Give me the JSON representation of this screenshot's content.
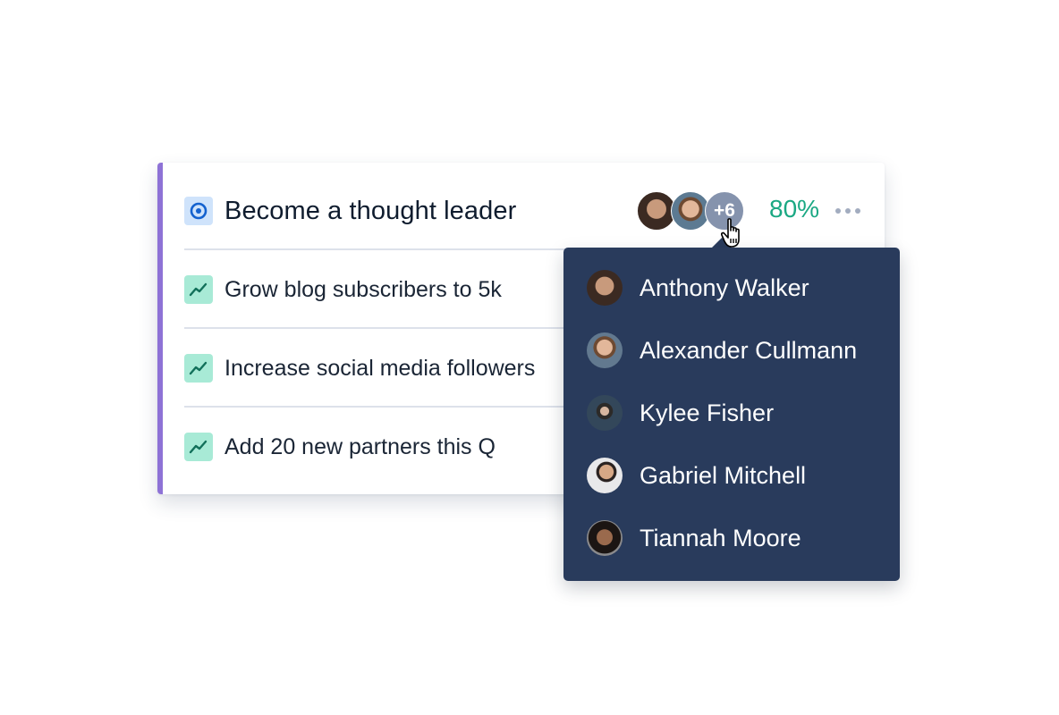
{
  "objective": {
    "title": "Become a thought leader",
    "icon": "target-icon",
    "progress_label": "80%",
    "progress": 0.8,
    "owners_overflow_label": "+6",
    "more_menu_icon": "more-horizontal-icon"
  },
  "key_results": [
    {
      "title": "Grow blog subscribers to 5k",
      "icon": "trend-up-icon"
    },
    {
      "title": "Increase social media followers",
      "icon": "trend-up-icon"
    },
    {
      "title": "Add 20 new partners this Q",
      "icon": "trend-up-icon"
    }
  ],
  "owners_dropdown": {
    "people": [
      {
        "name": "Anthony Walker"
      },
      {
        "name": "Alexander Cullmann"
      },
      {
        "name": "Kylee Fisher"
      },
      {
        "name": "Gabriel Mitchell"
      },
      {
        "name": "Tiannah Moore"
      }
    ]
  },
  "colors": {
    "accent_bar": "#8e72d6",
    "progress_green": "#1aa883",
    "dropdown_bg": "#293b5c",
    "goal_icon_bg": "#cfe3fb",
    "kr_icon_bg": "#a8ead6"
  }
}
